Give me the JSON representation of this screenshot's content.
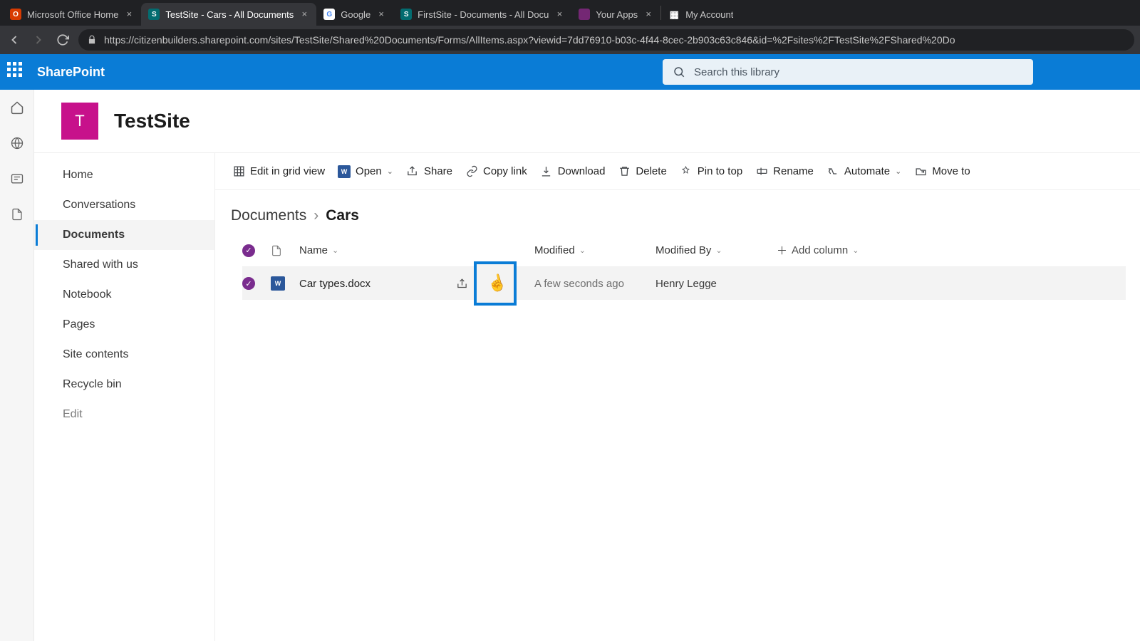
{
  "browser": {
    "tabs": [
      {
        "title": "Microsoft Office Home",
        "favicon_bg": "#d83b01",
        "favicon_text": "O"
      },
      {
        "title": "TestSite - Cars - All Documents",
        "favicon_bg": "#036c70",
        "favicon_text": "S",
        "active": true
      },
      {
        "title": "Google",
        "favicon_bg": "#ffffff",
        "favicon_text": "G"
      },
      {
        "title": "FirstSite - Documents - All Docu",
        "favicon_bg": "#036c70",
        "favicon_text": "S"
      },
      {
        "title": "Your Apps",
        "favicon_bg": "#742774",
        "favicon_text": ""
      },
      {
        "title": "My Account",
        "favicon_bg": "",
        "favicon_text": "▦"
      }
    ],
    "url": "https://citizenbuilders.sharepoint.com/sites/TestSite/Shared%20Documents/Forms/AllItems.aspx?viewid=7dd76910-b03c-4f44-8cec-2b903c63c846&id=%2Fsites%2FTestSite%2FShared%20Do"
  },
  "suite": {
    "product": "SharePoint",
    "search_placeholder": "Search this library"
  },
  "site": {
    "logo_letter": "T",
    "title": "TestSite"
  },
  "quicklaunch": {
    "items": [
      {
        "label": "Home"
      },
      {
        "label": "Conversations"
      },
      {
        "label": "Documents",
        "active": true
      },
      {
        "label": "Shared with us"
      },
      {
        "label": "Notebook"
      },
      {
        "label": "Pages"
      },
      {
        "label": "Site contents"
      },
      {
        "label": "Recycle bin"
      }
    ],
    "edit_label": "Edit"
  },
  "commands": {
    "edit_grid": "Edit in grid view",
    "open": "Open",
    "share": "Share",
    "copy_link": "Copy link",
    "download": "Download",
    "delete": "Delete",
    "pin": "Pin to top",
    "rename": "Rename",
    "automate": "Automate",
    "move_to": "Move to"
  },
  "breadcrumb": {
    "parent": "Documents",
    "current": "Cars"
  },
  "table": {
    "columns": {
      "name": "Name",
      "modified": "Modified",
      "modified_by": "Modified By",
      "add_column": "Add column"
    },
    "rows": [
      {
        "filename": "Car types.docx",
        "modified": "A few seconds ago",
        "modified_by": "Henry Legge",
        "selected": true
      }
    ]
  }
}
